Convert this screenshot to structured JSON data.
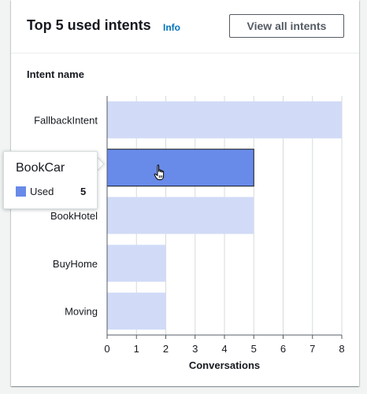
{
  "card": {
    "title": "Top 5 used intents",
    "info_label": "Info",
    "view_all_label": "View all intents",
    "y_axis_title": "Intent name"
  },
  "colors": {
    "bar": "#d1dbf7",
    "bar_highlight": "#688ae8",
    "grid": "#d5dbdb",
    "axis": "#545b64",
    "link": "#0073bb"
  },
  "chart_data": {
    "type": "bar",
    "orientation": "horizontal",
    "categories": [
      "FallbackIntent",
      "BookCar",
      "BookHotel",
      "BuyHome",
      "Moving"
    ],
    "series": [
      {
        "name": "Used",
        "values": [
          8,
          5,
          5,
          2,
          2
        ]
      }
    ],
    "xlabel": "Conversations",
    "ylabel": "Intent name",
    "xlim": [
      0,
      8
    ],
    "x_ticks": [
      "0",
      "1",
      "2",
      "3",
      "4",
      "5",
      "6",
      "7",
      "8"
    ],
    "grid": true,
    "highlighted_category": "BookCar"
  },
  "tooltip": {
    "title": "BookCar",
    "series_label": "Used",
    "value": "5"
  },
  "cursor": {
    "icon": "hand-pointer-icon"
  }
}
